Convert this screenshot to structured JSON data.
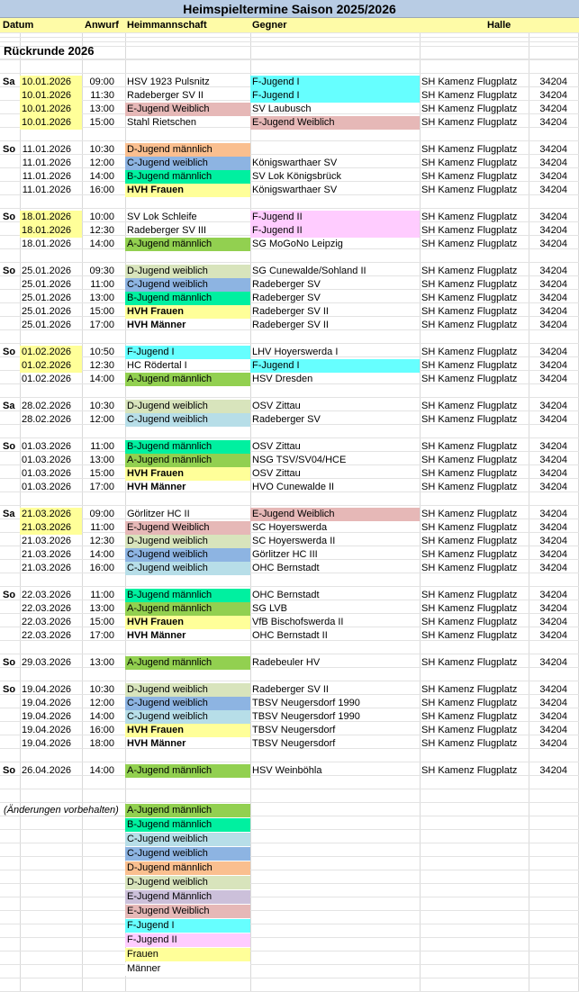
{
  "title": "Heimspieltermine Saison 2025/2026",
  "headers": [
    "Datum",
    "Anwurf",
    "Heimmannschaft",
    "Gegner",
    "Halle"
  ],
  "section": "Rückrunde 2026",
  "colors": {
    "A-Jugend männlich": "#92d050",
    "B-Jugend männlich": "#00f0a0",
    "C-Jugend weiblich (hell)": "#b7dee8",
    "C-Jugend weiblich (dunkel)": "#8db4e2",
    "D-Jugend männlich": "#fabf8f",
    "D-Jugend weiblich": "#d8e4bc",
    "E-Jugend Männlich": "#ccc0da",
    "E-Jugend Weiblich": "#e6b8b7",
    "F-Jugend I": "#66ffff",
    "F-Jugend II": "#ffccff",
    "Frauen": "#ffff99",
    "Datum": "#ffff99"
  },
  "games": [
    {
      "r": 0,
      "day": "Sa",
      "date": "10.01.2026",
      "dh": true,
      "time": "09:00",
      "home": "HSV 1923 Pulsnitz",
      "guest": "F-Jugend I",
      "gc": "#66ffff",
      "hall": "SH Kamenz Flugplatz",
      "num": "34204"
    },
    {
      "r": 1,
      "date": "10.01.2026",
      "dh": true,
      "time": "11:30",
      "home": "Radeberger SV II",
      "guest": "F-Jugend I",
      "gc": "#66ffff",
      "hall": "SH Kamenz Flugplatz",
      "num": "34204"
    },
    {
      "r": 2,
      "date": "10.01.2026",
      "dh": true,
      "time": "13:00",
      "home": "E-Jugend Weiblich",
      "hc": "#e6b8b7",
      "guest": "SV Laubusch",
      "hall": "SH Kamenz Flugplatz",
      "num": "34204"
    },
    {
      "r": 3,
      "date": "10.01.2026",
      "dh": true,
      "time": "15:00",
      "home": "Stahl Rietschen",
      "guest": "E-Jugend Weiblich",
      "gc": "#e6b8b7",
      "hall": "SH Kamenz Flugplatz",
      "num": "34204"
    },
    {
      "r": 5,
      "day": "So",
      "date": "11.01.2026",
      "time": "10:30",
      "home": "D-Jugend männlich",
      "hc": "#fabf8f",
      "guest": "",
      "hall": "SH Kamenz Flugplatz",
      "num": "34204"
    },
    {
      "r": 6,
      "date": "11.01.2026",
      "time": "12:00",
      "home": "C-Jugend weiblich",
      "hc": "#8db4e2",
      "guest": "Königswarthaer SV",
      "hall": "SH Kamenz Flugplatz",
      "num": "34204"
    },
    {
      "r": 7,
      "date": "11.01.2026",
      "time": "14:00",
      "home": "B-Jugend männlich",
      "hc": "#00f0a0",
      "guest": "SV Lok Königsbrück",
      "hall": "SH Kamenz Flugplatz",
      "num": "34204"
    },
    {
      "r": 8,
      "date": "11.01.2026",
      "time": "16:00",
      "home": "HVH Frauen",
      "hc": "#ffff99",
      "hb": true,
      "guest": "Königswarthaer SV",
      "hall": "SH Kamenz Flugplatz",
      "num": "34204"
    },
    {
      "r": 10,
      "day": "So",
      "date": "18.01.2026",
      "dh": true,
      "time": "10:00",
      "home": "SV Lok Schleife",
      "guest": "F-Jugend II",
      "gc": "#ffccff",
      "hall": "SH Kamenz Flugplatz",
      "num": "34204"
    },
    {
      "r": 11,
      "date": "18.01.2026",
      "dh": true,
      "time": "12:30",
      "home": "Radeberger SV III",
      "guest": "F-Jugend II",
      "gc": "#ffccff",
      "hall": "SH Kamenz Flugplatz",
      "num": "34204"
    },
    {
      "r": 12,
      "date": "18.01.2026",
      "time": "14:00",
      "home": "A-Jugend männlich",
      "hc": "#92d050",
      "guest": "SG MoGoNo Leipzig",
      "hall": "SH Kamenz Flugplatz",
      "num": "34204"
    },
    {
      "r": 14,
      "day": "So",
      "date": "25.01.2026",
      "time": "09:30",
      "home": "D-Jugend weiblich",
      "hc": "#d8e4bc",
      "guest": "SG Cunewalde/Sohland II",
      "hall": "SH Kamenz Flugplatz",
      "num": "34204"
    },
    {
      "r": 15,
      "date": "25.01.2026",
      "time": "11:00",
      "home": "C-Jugend weiblich",
      "hc": "#8db4e2",
      "guest": "Radeberger SV",
      "hall": "SH Kamenz Flugplatz",
      "num": "34204"
    },
    {
      "r": 16,
      "date": "25.01.2026",
      "time": "13:00",
      "home": "B-Jugend männlich",
      "hc": "#00f0a0",
      "guest": "Radeberger SV",
      "hall": "SH Kamenz Flugplatz",
      "num": "34204"
    },
    {
      "r": 17,
      "date": "25.01.2026",
      "time": "15:00",
      "home": "HVH Frauen",
      "hc": "#ffff99",
      "hb": true,
      "guest": "Radeberger SV II",
      "hall": "SH Kamenz Flugplatz",
      "num": "34204"
    },
    {
      "r": 18,
      "date": "25.01.2026",
      "time": "17:00",
      "home": "HVH Männer",
      "hb": true,
      "guest": "Radeberger SV II",
      "hall": "SH Kamenz Flugplatz",
      "num": "34204"
    },
    {
      "r": 20,
      "day": "So",
      "date": "01.02.2026",
      "dh": true,
      "time": "10:50",
      "home": "F-Jugend I",
      "hc": "#66ffff",
      "guest": "LHV Hoyerswerda I",
      "hall": "SH Kamenz Flugplatz",
      "num": "34204"
    },
    {
      "r": 21,
      "date": "01.02.2026",
      "dh": true,
      "time": "12:30",
      "home": "HC Rödertal I",
      "guest": "F-Jugend I",
      "gc": "#66ffff",
      "hall": "SH Kamenz Flugplatz",
      "num": "34204"
    },
    {
      "r": 22,
      "date": "01.02.2026",
      "time": "14:00",
      "home": "A-Jugend männlich",
      "hc": "#92d050",
      "guest": "HSV Dresden",
      "hall": "SH Kamenz Flugplatz",
      "num": "34204"
    },
    {
      "r": 24,
      "day": "Sa",
      "date": "28.02.2026",
      "time": "10:30",
      "home": "D-Jugend weiblich",
      "hc": "#d8e4bc",
      "guest": "OSV Zittau",
      "hall": "SH Kamenz Flugplatz",
      "num": "34204"
    },
    {
      "r": 25,
      "date": "28.02.2026",
      "time": "12:00",
      "home": "C-Jugend weiblich",
      "hc": "#b7dee8",
      "guest": "Radeberger SV",
      "hall": "SH Kamenz Flugplatz",
      "num": "34204"
    },
    {
      "r": 27,
      "day": "So",
      "date": "01.03.2026",
      "time": "11:00",
      "home": "B-Jugend männlich",
      "hc": "#00f0a0",
      "guest": "OSV Zittau",
      "hall": "SH Kamenz Flugplatz",
      "num": "34204"
    },
    {
      "r": 28,
      "date": "01.03.2026",
      "time": "13:00",
      "home": "A-Jugend männlich",
      "hc": "#92d050",
      "guest": "NSG TSV/SV04/HCE",
      "hall": "SH Kamenz Flugplatz",
      "num": "34204"
    },
    {
      "r": 29,
      "date": "01.03.2026",
      "time": "15:00",
      "home": "HVH Frauen",
      "hc": "#ffff99",
      "hb": true,
      "guest": "OSV Zittau",
      "hall": "SH Kamenz Flugplatz",
      "num": "34204"
    },
    {
      "r": 30,
      "date": "01.03.2026",
      "time": "17:00",
      "home": "HVH Männer",
      "hb": true,
      "guest": "HVO Cunewalde II",
      "hall": "SH Kamenz Flugplatz",
      "num": "34204"
    },
    {
      "r": 32,
      "day": "Sa",
      "date": "21.03.2026",
      "dh": true,
      "time": "09:00",
      "home": "Görlitzer HC II",
      "guest": "E-Jugend Weiblich",
      "gc": "#e6b8b7",
      "hall": "SH Kamenz Flugplatz",
      "num": "34204"
    },
    {
      "r": 33,
      "date": "21.03.2026",
      "dh": true,
      "time": "11:00",
      "home": "E-Jugend Weiblich",
      "hc": "#e6b8b7",
      "guest": "SC Hoyerswerda",
      "hall": "SH Kamenz Flugplatz",
      "num": "34204"
    },
    {
      "r": 34,
      "date": "21.03.2026",
      "time": "12:30",
      "home": "D-Jugend weiblich",
      "hc": "#d8e4bc",
      "guest": "SC Hoyerswerda II",
      "hall": "SH Kamenz Flugplatz",
      "num": "34204"
    },
    {
      "r": 35,
      "date": "21.03.2026",
      "time": "14:00",
      "home": "C-Jugend weiblich",
      "hc": "#8db4e2",
      "guest": "Görlitzer HC III",
      "hall": "SH Kamenz Flugplatz",
      "num": "34204"
    },
    {
      "r": 36,
      "date": "21.03.2026",
      "time": "16:00",
      "home": "C-Jugend weiblich",
      "hc": "#b7dee8",
      "guest": "OHC Bernstadt",
      "hall": "SH Kamenz Flugplatz",
      "num": "34204"
    },
    {
      "r": 38,
      "day": "So",
      "date": "22.03.2026",
      "time": "11:00",
      "home": "B-Jugend männlich",
      "hc": "#00f0a0",
      "guest": "OHC Bernstadt",
      "hall": "SH Kamenz Flugplatz",
      "num": "34204"
    },
    {
      "r": 39,
      "date": "22.03.2026",
      "time": "13:00",
      "home": "A-Jugend männlich",
      "hc": "#92d050",
      "guest": "SG LVB",
      "hall": "SH Kamenz Flugplatz",
      "num": "34204"
    },
    {
      "r": 40,
      "date": "22.03.2026",
      "time": "15:00",
      "home": "HVH Frauen",
      "hc": "#ffff99",
      "hb": true,
      "guest": "VfB Bischofswerda II",
      "hall": "SH Kamenz Flugplatz",
      "num": "34204"
    },
    {
      "r": 41,
      "date": "22.03.2026",
      "time": "17:00",
      "home": "HVH Männer",
      "hb": true,
      "guest": "OHC Bernstadt II",
      "hall": "SH Kamenz Flugplatz",
      "num": "34204"
    },
    {
      "r": 43,
      "day": "So",
      "date": "29.03.2026",
      "time": "13:00",
      "home": "A-Jugend männlich",
      "hc": "#92d050",
      "guest": "Radebeuler HV",
      "hall": "SH Kamenz Flugplatz",
      "num": "34204"
    },
    {
      "r": 45,
      "day": "So",
      "date": "19.04.2026",
      "time": "10:30",
      "home": "D-Jugend weiblich",
      "hc": "#d8e4bc",
      "guest": "Radeberger SV II",
      "hall": "SH Kamenz Flugplatz",
      "num": "34204"
    },
    {
      "r": 46,
      "date": "19.04.2026",
      "time": "12:00",
      "home": "C-Jugend weiblich",
      "hc": "#8db4e2",
      "guest": "TBSV Neugersdorf 1990",
      "hall": "SH Kamenz Flugplatz",
      "num": "34204"
    },
    {
      "r": 47,
      "date": "19.04.2026",
      "time": "14:00",
      "home": "C-Jugend weiblich",
      "hc": "#b7dee8",
      "guest": "TBSV Neugersdorf 1990",
      "hall": "SH Kamenz Flugplatz",
      "num": "34204"
    },
    {
      "r": 48,
      "date": "19.04.2026",
      "time": "16:00",
      "home": "HVH Frauen",
      "hc": "#ffff99",
      "hb": true,
      "guest": "TBSV Neugersdorf",
      "hall": "SH Kamenz Flugplatz",
      "num": "34204"
    },
    {
      "r": 49,
      "date": "19.04.2026",
      "time": "18:00",
      "home": "HVH Männer",
      "hb": true,
      "guest": "TBSV Neugersdorf",
      "hall": "SH Kamenz Flugplatz",
      "num": "34204"
    },
    {
      "r": 51,
      "day": "So",
      "date": "26.04.2026",
      "time": "14:00",
      "home": "A-Jugend männlich",
      "hc": "#92d050",
      "guest": "HSV Weinböhla",
      "hall": "SH Kamenz Flugplatz",
      "num": "34204"
    }
  ],
  "note": "(Änderungen vorbehalten)",
  "legend": [
    {
      "label": "A-Jugend männlich",
      "color": "#92d050"
    },
    {
      "label": "B-Jugend männlich",
      "color": "#00f0a0"
    },
    {
      "label": "C-Jugend weiblich",
      "color": "#b7dee8"
    },
    {
      "label": "C-Jugend weiblich",
      "color": "#8db4e2"
    },
    {
      "label": "D-Jugend männlich",
      "color": "#fabf8f"
    },
    {
      "label": "D-Jugend weiblich",
      "color": "#d8e4bc"
    },
    {
      "label": "E-Jugend Männlich",
      "color": "#ccc0da"
    },
    {
      "label": "E-Jugend Weiblich",
      "color": "#e6b8b7"
    },
    {
      "label": "F-Jugend I",
      "color": "#66ffff"
    },
    {
      "label": "F-Jugend II",
      "color": "#ffccff"
    },
    {
      "label": "Frauen",
      "color": "#ffff99"
    },
    {
      "label": "Männer",
      "color": "#ffffff"
    }
  ]
}
